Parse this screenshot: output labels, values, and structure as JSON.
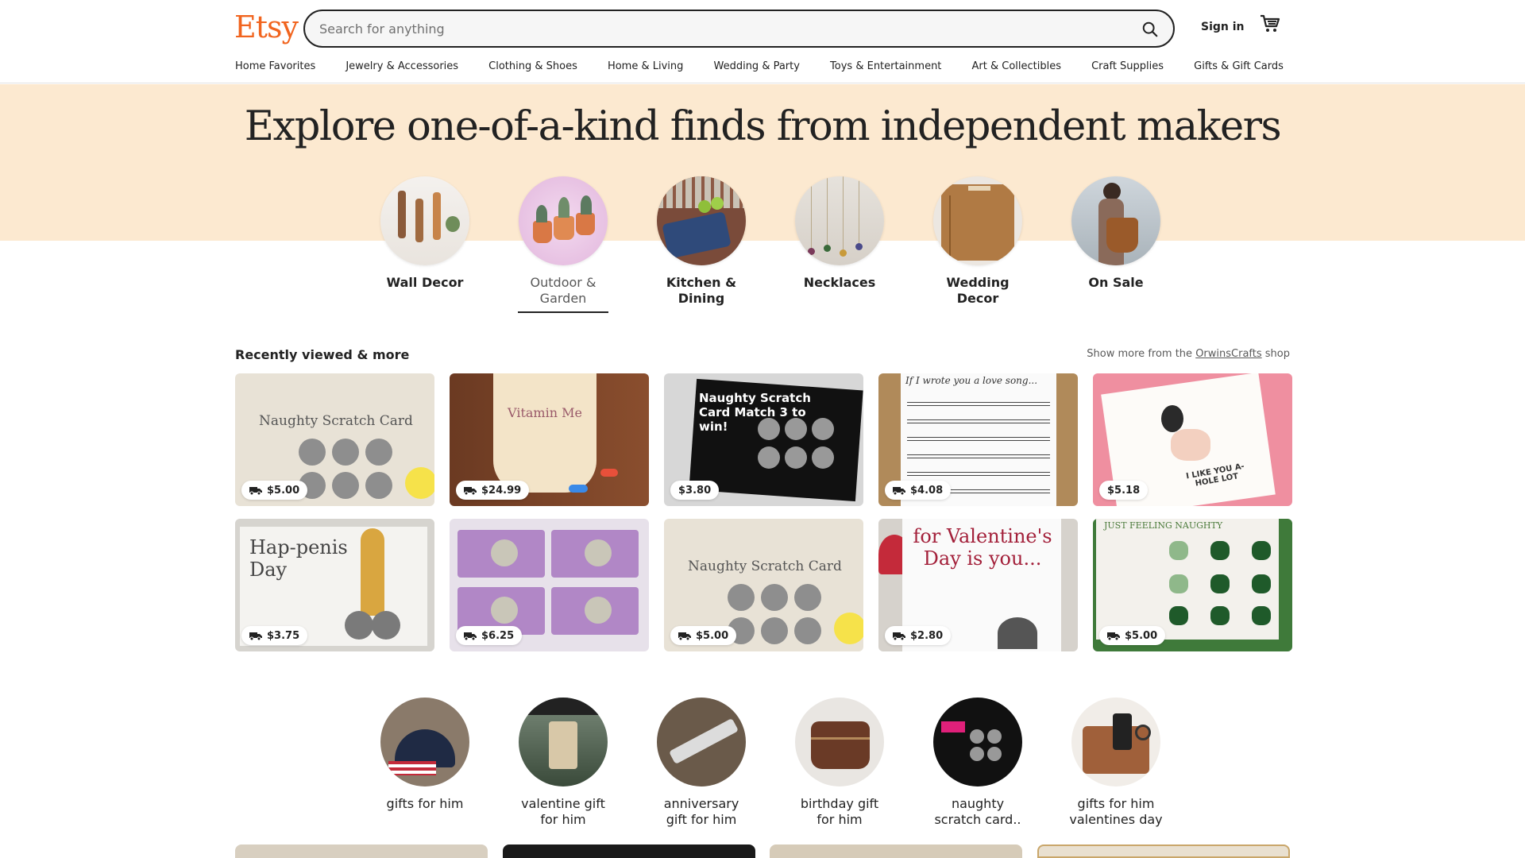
{
  "header": {
    "logo": "Etsy",
    "search_placeholder": "Search for anything",
    "signin_label": "Sign in"
  },
  "nav": [
    "Home Favorites",
    "Jewelry & Accessories",
    "Clothing & Shoes",
    "Home & Living",
    "Wedding & Party",
    "Toys & Entertainment",
    "Art & Collectibles",
    "Craft Supplies",
    "Gifts & Gift Cards"
  ],
  "hero": {
    "title": "Explore one-of-a-kind finds from independent makers",
    "categories": [
      {
        "line1": "Wall Decor",
        "line2": ""
      },
      {
        "line1": "Outdoor &",
        "line2": "Garden",
        "active": true
      },
      {
        "line1": "Kitchen &",
        "line2": "Dining"
      },
      {
        "line1": "Necklaces",
        "line2": ""
      },
      {
        "line1": "Wedding",
        "line2": "Decor"
      },
      {
        "line1": "On Sale",
        "line2": ""
      }
    ]
  },
  "recent": {
    "title": "Recently viewed & more",
    "more_prefix": "Show more from the",
    "shop_name": "OrwinsCrafts",
    "more_suffix": "shop",
    "items": [
      {
        "price": "$5.00",
        "free_shipping": true,
        "image_text": "Naughty Scratch Card"
      },
      {
        "price": "$24.99",
        "free_shipping": true,
        "image_text": "Vitamin Me"
      },
      {
        "price": "$3.80",
        "free_shipping": false,
        "image_text": "Naughty Scratch Card Match 3 to win!"
      },
      {
        "price": "$4.08",
        "free_shipping": true,
        "image_text": "If I wrote you a love song..."
      },
      {
        "price": "$5.18",
        "free_shipping": false,
        "image_text": "I LIKE YOU A-HOLE LOT"
      },
      {
        "price": "$3.75",
        "free_shipping": true,
        "image_text": "Hap-penis Day"
      },
      {
        "price": "$6.25",
        "free_shipping": true,
        "image_text": ""
      },
      {
        "price": "$5.00",
        "free_shipping": true,
        "image_text": "Naughty Scratch Card"
      },
      {
        "price": "$2.80",
        "free_shipping": true,
        "image_text": "for Valentine's Day is you..."
      },
      {
        "price": "$5.00",
        "free_shipping": true,
        "image_text": "JUST FEELING NAUGHTY"
      }
    ]
  },
  "gifts": [
    {
      "line1": "gifts for him",
      "line2": ""
    },
    {
      "line1": "valentine gift",
      "line2": "for him"
    },
    {
      "line1": "anniversary",
      "line2": "gift for him"
    },
    {
      "line1": "birthday gift",
      "line2": "for him"
    },
    {
      "line1": "naughty",
      "line2": "scratch card.."
    },
    {
      "line1": "gifts for him",
      "line2": "valentines day"
    }
  ],
  "colors": {
    "brand": "#f1641e",
    "hero_bg": "#fce9d0"
  },
  "icons": {
    "search": "search-icon",
    "cart": "cart-icon",
    "truck": "free-shipping-truck-icon"
  }
}
